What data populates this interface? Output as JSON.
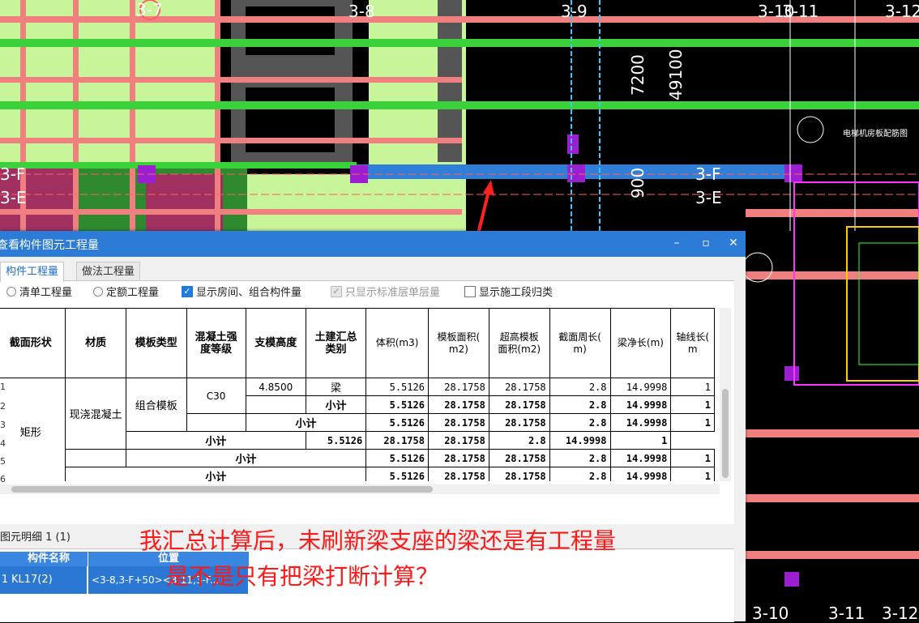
{
  "cad": {
    "axis_labels": [
      "3-7",
      "3-8",
      "3-9",
      "3-10",
      "3-11",
      "3-12",
      "3-F",
      "3-E",
      "3-F",
      "3-E",
      "3-10",
      "3-11",
      "3-12"
    ],
    "dimensions": [
      "7200",
      "49100",
      "900"
    ],
    "small_note": "电梯机房板配筋图"
  },
  "dialog": {
    "title": "查看构件图元工程量",
    "controls": {
      "minimize": "–",
      "maximize": "▫",
      "close": "✕"
    },
    "tabs": [
      "构件工程量",
      "做法工程量"
    ],
    "active_tab": 0,
    "options": [
      {
        "type": "radio",
        "label": "清单工程量",
        "checked": false
      },
      {
        "type": "radio",
        "label": "定额工程量",
        "checked": false
      },
      {
        "type": "checkbox",
        "label": "显示房间、组合构件量",
        "checked": true,
        "enabled": true
      },
      {
        "type": "checkbox",
        "label": "只显示标准层单层量",
        "checked": true,
        "enabled": false
      },
      {
        "type": "checkbox",
        "label": "显示施工段归类",
        "checked": false,
        "enabled": true
      }
    ],
    "table": {
      "headers": [
        "截面形状",
        "材质",
        "模板类型",
        "混凝土强度等级",
        "支模高度",
        "土建汇总类别",
        "体积(m3)",
        "模板面积(m2)",
        "超高模板面积(m2)",
        "截面周长(m)",
        "梁净长(m)",
        "轴线长(m)"
      ],
      "header_display": [
        "截面形状",
        "材质",
        "模板类型",
        "混凝土强\n度等级",
        "支模高度",
        "土建汇总\n类别",
        "体积(m3)",
        "模板面积(\nm2)",
        "超高模板\n面积(m2)",
        "截面周长(\nm)",
        "梁净长(m)",
        "轴线长(\nm"
      ],
      "row_numbers": [
        "1",
        "2",
        "3",
        "4",
        "5",
        "6"
      ],
      "section_shape": "矩形",
      "material": "现浇混凝土",
      "formwork": "组合模板",
      "grade": "C30",
      "height": "4.8500",
      "category_beam": "梁",
      "subtotal": "小计",
      "rows": [
        [
          "5.5126",
          "28.1758",
          "28.1758",
          "2.8",
          "14.9998",
          "1"
        ],
        [
          "5.5126",
          "28.1758",
          "28.1758",
          "2.8",
          "14.9998",
          "1"
        ],
        [
          "5.5126",
          "28.1758",
          "28.1758",
          "2.8",
          "14.9998",
          "1"
        ],
        [
          "5.5126",
          "28.1758",
          "28.1758",
          "2.8",
          "14.9998",
          "1"
        ],
        [
          "5.5126",
          "28.1758",
          "28.1758",
          "2.8",
          "14.9998",
          "1"
        ],
        [
          "5.5126",
          "28.1758",
          "28.1758",
          "2.8",
          "14.9998",
          "1"
        ]
      ]
    },
    "detail": {
      "label": "图元明细",
      "count": "1 (1)",
      "headers": [
        "构件名称",
        "位置"
      ],
      "row_number": "1",
      "row": [
        "KL17(2)",
        "<3-8,3-F+50><3-11,3-F..."
      ]
    }
  },
  "annotation": {
    "line1": "我汇总计算后，未刷新梁支座的梁还是有工程量",
    "line2": "是不是只有把梁打断计算？",
    "color": "#ff1818"
  }
}
